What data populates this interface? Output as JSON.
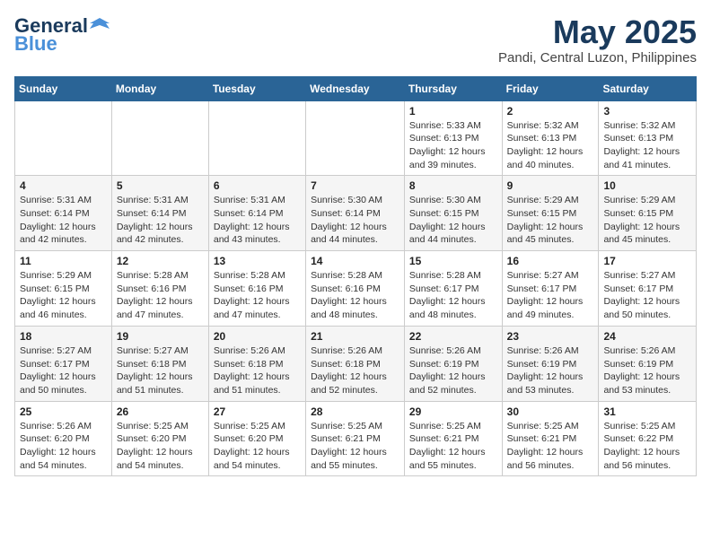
{
  "logo": {
    "general": "General",
    "blue": "Blue"
  },
  "header": {
    "title": "May 2025",
    "location": "Pandi, Central Luzon, Philippines"
  },
  "days_of_week": [
    "Sunday",
    "Monday",
    "Tuesday",
    "Wednesday",
    "Thursday",
    "Friday",
    "Saturday"
  ],
  "weeks": [
    [
      {
        "day": "",
        "info": ""
      },
      {
        "day": "",
        "info": ""
      },
      {
        "day": "",
        "info": ""
      },
      {
        "day": "",
        "info": ""
      },
      {
        "day": "1",
        "info": "Sunrise: 5:33 AM\nSunset: 6:13 PM\nDaylight: 12 hours\nand 39 minutes."
      },
      {
        "day": "2",
        "info": "Sunrise: 5:32 AM\nSunset: 6:13 PM\nDaylight: 12 hours\nand 40 minutes."
      },
      {
        "day": "3",
        "info": "Sunrise: 5:32 AM\nSunset: 6:13 PM\nDaylight: 12 hours\nand 41 minutes."
      }
    ],
    [
      {
        "day": "4",
        "info": "Sunrise: 5:31 AM\nSunset: 6:14 PM\nDaylight: 12 hours\nand 42 minutes."
      },
      {
        "day": "5",
        "info": "Sunrise: 5:31 AM\nSunset: 6:14 PM\nDaylight: 12 hours\nand 42 minutes."
      },
      {
        "day": "6",
        "info": "Sunrise: 5:31 AM\nSunset: 6:14 PM\nDaylight: 12 hours\nand 43 minutes."
      },
      {
        "day": "7",
        "info": "Sunrise: 5:30 AM\nSunset: 6:14 PM\nDaylight: 12 hours\nand 44 minutes."
      },
      {
        "day": "8",
        "info": "Sunrise: 5:30 AM\nSunset: 6:15 PM\nDaylight: 12 hours\nand 44 minutes."
      },
      {
        "day": "9",
        "info": "Sunrise: 5:29 AM\nSunset: 6:15 PM\nDaylight: 12 hours\nand 45 minutes."
      },
      {
        "day": "10",
        "info": "Sunrise: 5:29 AM\nSunset: 6:15 PM\nDaylight: 12 hours\nand 45 minutes."
      }
    ],
    [
      {
        "day": "11",
        "info": "Sunrise: 5:29 AM\nSunset: 6:15 PM\nDaylight: 12 hours\nand 46 minutes."
      },
      {
        "day": "12",
        "info": "Sunrise: 5:28 AM\nSunset: 6:16 PM\nDaylight: 12 hours\nand 47 minutes."
      },
      {
        "day": "13",
        "info": "Sunrise: 5:28 AM\nSunset: 6:16 PM\nDaylight: 12 hours\nand 47 minutes."
      },
      {
        "day": "14",
        "info": "Sunrise: 5:28 AM\nSunset: 6:16 PM\nDaylight: 12 hours\nand 48 minutes."
      },
      {
        "day": "15",
        "info": "Sunrise: 5:28 AM\nSunset: 6:17 PM\nDaylight: 12 hours\nand 48 minutes."
      },
      {
        "day": "16",
        "info": "Sunrise: 5:27 AM\nSunset: 6:17 PM\nDaylight: 12 hours\nand 49 minutes."
      },
      {
        "day": "17",
        "info": "Sunrise: 5:27 AM\nSunset: 6:17 PM\nDaylight: 12 hours\nand 50 minutes."
      }
    ],
    [
      {
        "day": "18",
        "info": "Sunrise: 5:27 AM\nSunset: 6:17 PM\nDaylight: 12 hours\nand 50 minutes."
      },
      {
        "day": "19",
        "info": "Sunrise: 5:27 AM\nSunset: 6:18 PM\nDaylight: 12 hours\nand 51 minutes."
      },
      {
        "day": "20",
        "info": "Sunrise: 5:26 AM\nSunset: 6:18 PM\nDaylight: 12 hours\nand 51 minutes."
      },
      {
        "day": "21",
        "info": "Sunrise: 5:26 AM\nSunset: 6:18 PM\nDaylight: 12 hours\nand 52 minutes."
      },
      {
        "day": "22",
        "info": "Sunrise: 5:26 AM\nSunset: 6:19 PM\nDaylight: 12 hours\nand 52 minutes."
      },
      {
        "day": "23",
        "info": "Sunrise: 5:26 AM\nSunset: 6:19 PM\nDaylight: 12 hours\nand 53 minutes."
      },
      {
        "day": "24",
        "info": "Sunrise: 5:26 AM\nSunset: 6:19 PM\nDaylight: 12 hours\nand 53 minutes."
      }
    ],
    [
      {
        "day": "25",
        "info": "Sunrise: 5:26 AM\nSunset: 6:20 PM\nDaylight: 12 hours\nand 54 minutes."
      },
      {
        "day": "26",
        "info": "Sunrise: 5:25 AM\nSunset: 6:20 PM\nDaylight: 12 hours\nand 54 minutes."
      },
      {
        "day": "27",
        "info": "Sunrise: 5:25 AM\nSunset: 6:20 PM\nDaylight: 12 hours\nand 54 minutes."
      },
      {
        "day": "28",
        "info": "Sunrise: 5:25 AM\nSunset: 6:21 PM\nDaylight: 12 hours\nand 55 minutes."
      },
      {
        "day": "29",
        "info": "Sunrise: 5:25 AM\nSunset: 6:21 PM\nDaylight: 12 hours\nand 55 minutes."
      },
      {
        "day": "30",
        "info": "Sunrise: 5:25 AM\nSunset: 6:21 PM\nDaylight: 12 hours\nand 56 minutes."
      },
      {
        "day": "31",
        "info": "Sunrise: 5:25 AM\nSunset: 6:22 PM\nDaylight: 12 hours\nand 56 minutes."
      }
    ]
  ]
}
